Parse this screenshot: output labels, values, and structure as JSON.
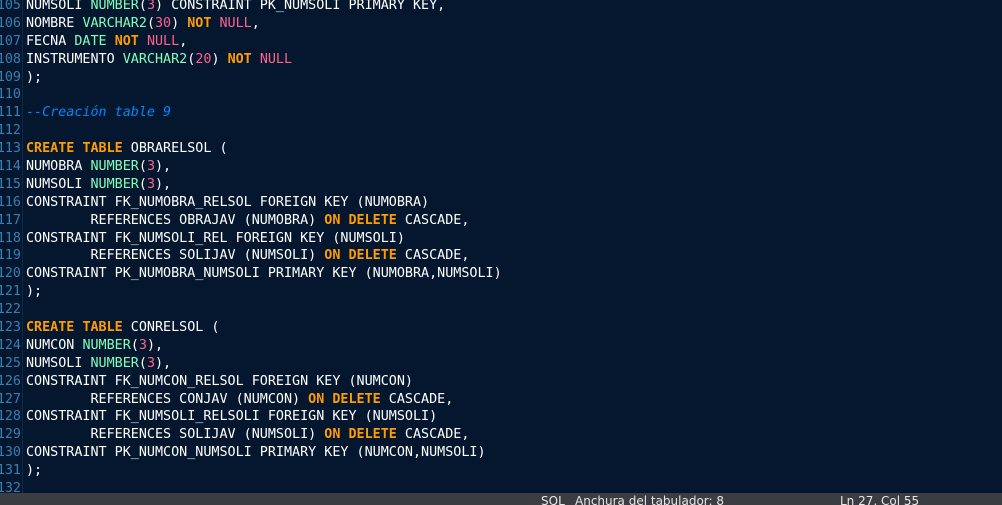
{
  "editor": {
    "lines": [
      {
        "no": "105",
        "tokens": [
          [
            "t",
            "NUMSOLI "
          ],
          [
            "ty",
            "NUMBER"
          ],
          [
            "t",
            "("
          ],
          [
            "num",
            "3"
          ],
          [
            "t",
            ") CONSTRAINT PK_NUMSOLI PRIMARY KEY,"
          ]
        ]
      },
      {
        "no": "106",
        "tokens": [
          [
            "t",
            "NOMBRE "
          ],
          [
            "ty",
            "VARCHAR2"
          ],
          [
            "t",
            "("
          ],
          [
            "num",
            "30"
          ],
          [
            "t",
            ") "
          ],
          [
            "kw",
            "NOT"
          ],
          [
            "t",
            " "
          ],
          [
            "nl",
            "NULL"
          ],
          [
            "t",
            ","
          ]
        ]
      },
      {
        "no": "107",
        "tokens": [
          [
            "t",
            "FECNA "
          ],
          [
            "ty",
            "DATE"
          ],
          [
            "t",
            " "
          ],
          [
            "kw",
            "NOT"
          ],
          [
            "t",
            " "
          ],
          [
            "nl",
            "NULL"
          ],
          [
            "t",
            ","
          ]
        ]
      },
      {
        "no": "108",
        "tokens": [
          [
            "t",
            "INSTRUMENTO "
          ],
          [
            "ty",
            "VARCHAR2"
          ],
          [
            "t",
            "("
          ],
          [
            "num",
            "20"
          ],
          [
            "t",
            ") "
          ],
          [
            "kw",
            "NOT"
          ],
          [
            "t",
            " "
          ],
          [
            "nl",
            "NULL"
          ]
        ]
      },
      {
        "no": "109",
        "tokens": [
          [
            "t",
            ");"
          ]
        ]
      },
      {
        "no": "110",
        "tokens": []
      },
      {
        "no": "111",
        "tokens": [
          [
            "cm",
            "--Creación table 9"
          ]
        ]
      },
      {
        "no": "112",
        "tokens": []
      },
      {
        "no": "113",
        "tokens": [
          [
            "kw",
            "CREATE"
          ],
          [
            "t",
            " "
          ],
          [
            "kw",
            "TABLE"
          ],
          [
            "t",
            " OBRARELSOL ("
          ]
        ]
      },
      {
        "no": "114",
        "tokens": [
          [
            "t",
            "NUMOBRA "
          ],
          [
            "ty",
            "NUMBER"
          ],
          [
            "t",
            "("
          ],
          [
            "num",
            "3"
          ],
          [
            "t",
            "),"
          ]
        ]
      },
      {
        "no": "115",
        "tokens": [
          [
            "t",
            "NUMSOLI "
          ],
          [
            "ty",
            "NUMBER"
          ],
          [
            "t",
            "("
          ],
          [
            "num",
            "3"
          ],
          [
            "t",
            "),"
          ]
        ]
      },
      {
        "no": "116",
        "tokens": [
          [
            "t",
            "CONSTRAINT FK_NUMOBRA_RELSOL FOREIGN KEY (NUMOBRA)"
          ]
        ]
      },
      {
        "no": "117",
        "tokens": [
          [
            "t",
            "        REFERENCES OBRAJAV (NUMOBRA) "
          ],
          [
            "kw",
            "ON"
          ],
          [
            "t",
            " "
          ],
          [
            "kw",
            "DELETE"
          ],
          [
            "t",
            " CASCADE,"
          ]
        ]
      },
      {
        "no": "118",
        "tokens": [
          [
            "t",
            "CONSTRAINT FK_NUMSOLI_REL FOREIGN KEY (NUMSOLI)"
          ]
        ]
      },
      {
        "no": "119",
        "tokens": [
          [
            "t",
            "        REFERENCES SOLIJAV (NUMSOLI) "
          ],
          [
            "kw",
            "ON"
          ],
          [
            "t",
            " "
          ],
          [
            "kw",
            "DELETE"
          ],
          [
            "t",
            " CASCADE,"
          ]
        ]
      },
      {
        "no": "120",
        "tokens": [
          [
            "t",
            "CONSTRAINT PK_NUMOBRA_NUMSOLI PRIMARY KEY (NUMOBRA,NUMSOLI)"
          ]
        ]
      },
      {
        "no": "121",
        "tokens": [
          [
            "t",
            ");"
          ]
        ]
      },
      {
        "no": "122",
        "tokens": []
      },
      {
        "no": "123",
        "tokens": [
          [
            "kw",
            "CREATE"
          ],
          [
            "t",
            " "
          ],
          [
            "kw",
            "TABLE"
          ],
          [
            "t",
            " CONRELSOL ("
          ]
        ]
      },
      {
        "no": "124",
        "tokens": [
          [
            "t",
            "NUMCON "
          ],
          [
            "ty",
            "NUMBER"
          ],
          [
            "t",
            "("
          ],
          [
            "num",
            "3"
          ],
          [
            "t",
            "),"
          ]
        ]
      },
      {
        "no": "125",
        "tokens": [
          [
            "t",
            "NUMSOLI "
          ],
          [
            "ty",
            "NUMBER"
          ],
          [
            "t",
            "("
          ],
          [
            "num",
            "3"
          ],
          [
            "t",
            "),"
          ]
        ]
      },
      {
        "no": "126",
        "tokens": [
          [
            "t",
            "CONSTRAINT FK_NUMCON_RELSOL FOREIGN KEY (NUMCON)"
          ]
        ]
      },
      {
        "no": "127",
        "tokens": [
          [
            "t",
            "        REFERENCES CONJAV (NUMCON) "
          ],
          [
            "kw",
            "ON"
          ],
          [
            "t",
            " "
          ],
          [
            "kw",
            "DELETE"
          ],
          [
            "t",
            " CASCADE,"
          ]
        ]
      },
      {
        "no": "128",
        "tokens": [
          [
            "t",
            "CONSTRAINT FK_NUMSOLI_RELSOLI FOREIGN KEY (NUMSOLI)"
          ]
        ]
      },
      {
        "no": "129",
        "tokens": [
          [
            "t",
            "        REFERENCES SOLIJAV (NUMSOLI) "
          ],
          [
            "kw",
            "ON"
          ],
          [
            "t",
            " "
          ],
          [
            "kw",
            "DELETE"
          ],
          [
            "t",
            " CASCADE,"
          ]
        ]
      },
      {
        "no": "130",
        "tokens": [
          [
            "t",
            "CONSTRAINT PK_NUMCON_NUMSOLI PRIMARY KEY (NUMCON,NUMSOLI)"
          ]
        ]
      },
      {
        "no": "131",
        "tokens": [
          [
            "t",
            ");"
          ]
        ]
      },
      {
        "no": "132",
        "tokens": []
      }
    ]
  },
  "colors": {
    "background": "#04172f",
    "keyword": "#ff9d00",
    "type": "#80ffbb",
    "number": "#ff628c",
    "comment": "#0088ff",
    "line_number": "#3b7fb0",
    "statusbar": "#3a3d41"
  },
  "statusbar": {
    "language": "SQL",
    "tab_width": "Anchura del tabulador: 8",
    "position": "Ln 27, Col 55"
  }
}
